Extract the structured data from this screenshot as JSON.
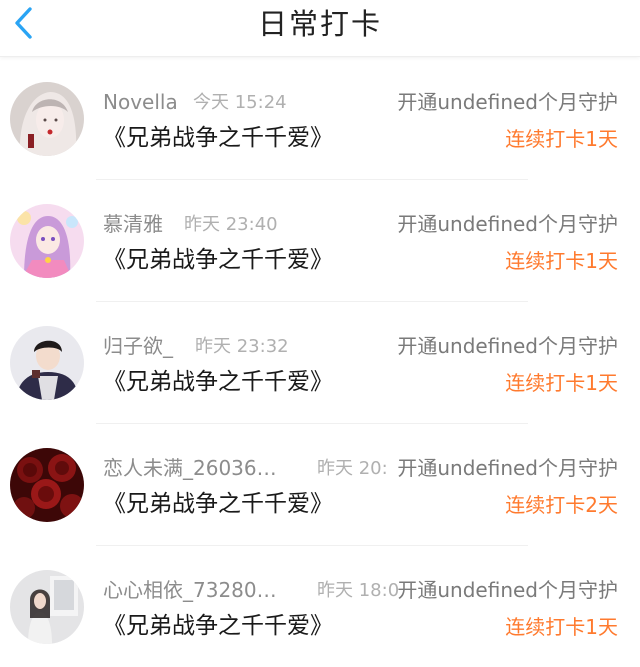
{
  "header": {
    "title": "日常打卡",
    "back_icon": "chevron-left-icon"
  },
  "colors": {
    "back_icon": "#2aa4f4",
    "streak_text": "#ff7a2e",
    "name_text": "#8c8c8c",
    "time_text": "#b0b0b0"
  },
  "items": [
    {
      "name": "Novella",
      "time": "今天 15:24",
      "guard": "开通undefined个月守护",
      "book": "《兄弟战争之千千爱》",
      "streak": "连续打卡1天",
      "avatar": "avatar-illustrated-girl"
    },
    {
      "name": "慕清雅",
      "time": "昨天 23:40",
      "guard": "开通undefined个月守护",
      "book": "《兄弟战争之千千爱》",
      "streak": "连续打卡1天",
      "avatar": "avatar-anime-girl"
    },
    {
      "name": "归子欲_",
      "time": "昨天 23:32",
      "guard": "开通undefined个月守护",
      "book": "《兄弟战争之千千爱》",
      "streak": "连续打卡1天",
      "avatar": "avatar-young-man"
    },
    {
      "name": "恋人未满_26036…",
      "time": "昨天 20:",
      "guard": "开通undefined个月守护",
      "book": "《兄弟战争之千千爱》",
      "streak": "连续打卡2天",
      "avatar": "avatar-red-roses"
    },
    {
      "name": "心心相依_73280…",
      "time": "昨天 18:0",
      "guard": "开通undefined个月守护",
      "book": "《兄弟战争之千千爱》",
      "streak": "连续打卡1天",
      "avatar": "avatar-girl-room"
    }
  ]
}
